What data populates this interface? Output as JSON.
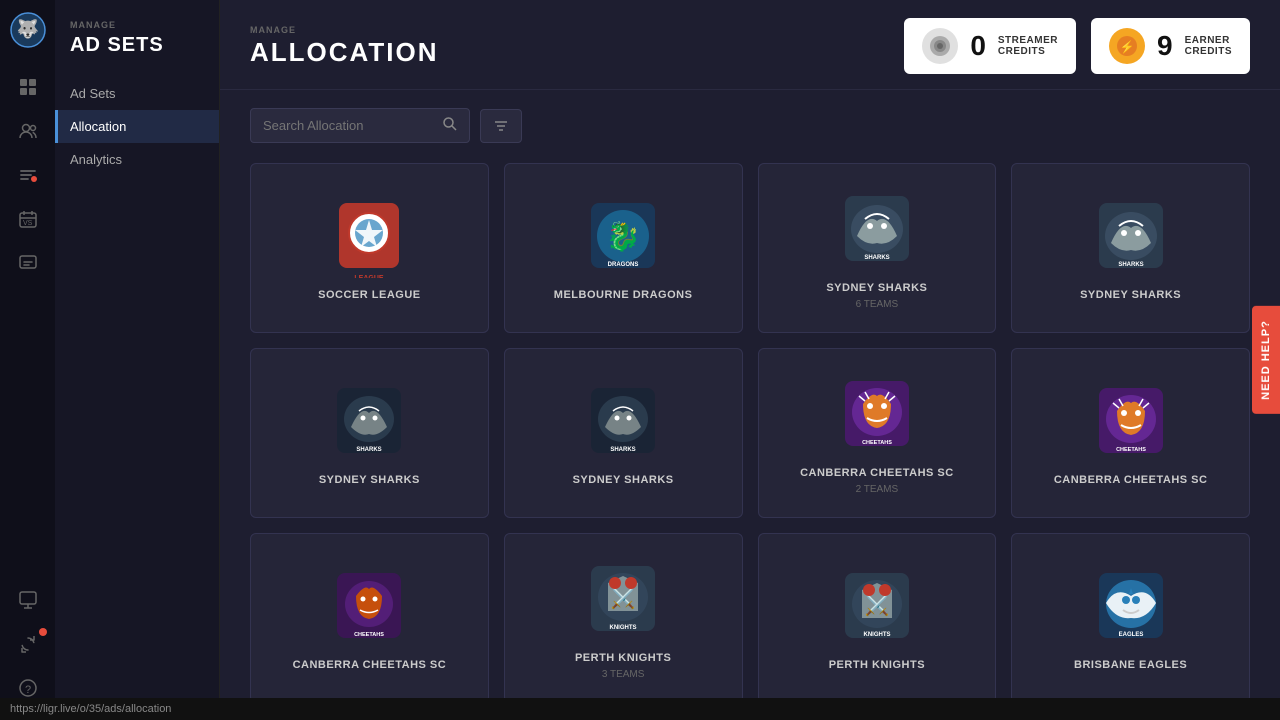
{
  "app": {
    "logo": "🐺",
    "status_bar_url": "https://ligr.live/o/35/ads/allocation"
  },
  "icon_bar": {
    "items": [
      {
        "name": "dashboard-icon",
        "icon": "▦",
        "active": false
      },
      {
        "name": "users-icon",
        "icon": "👥",
        "active": false
      },
      {
        "name": "campaigns-icon",
        "icon": "📢",
        "active": false
      },
      {
        "name": "calendar-icon",
        "icon": "📅",
        "active": false
      },
      {
        "name": "messages-icon",
        "icon": "💬",
        "active": false,
        "badge": false
      },
      {
        "name": "monitor-icon",
        "icon": "🖥",
        "active": false
      },
      {
        "name": "sync-icon",
        "icon": "↻",
        "active": false
      },
      {
        "name": "help-bottom-icon",
        "icon": "?",
        "active": false
      }
    ]
  },
  "sidebar": {
    "section_label": "MANAGE",
    "title": "AD SETS",
    "nav_items": [
      {
        "label": "Ad Sets",
        "active": false
      },
      {
        "label": "Allocation",
        "active": true
      },
      {
        "label": "Analytics",
        "active": false
      }
    ]
  },
  "header": {
    "section_label": "MANAGE",
    "title": "ALLOCATION",
    "streamer_credits": {
      "count": "0",
      "label_line1": "STREAMER",
      "label_line2": "CREDITS"
    },
    "earner_credits": {
      "count": "9",
      "label_line1": "EARNER",
      "label_line2": "CREDITS"
    }
  },
  "search": {
    "placeholder": "Search Allocation"
  },
  "help_tab": "NEED HELP?",
  "cards": [
    {
      "id": 1,
      "name": "SOCCER LEAGUE",
      "teams": "",
      "logo_type": "soccer_league",
      "color1": "#c0392b",
      "color2": "#2980b9"
    },
    {
      "id": 2,
      "name": "MELBOURNE DRAGONS",
      "teams": "",
      "logo_type": "dragons",
      "color1": "#1a6b9a",
      "color2": "#27ae60"
    },
    {
      "id": 3,
      "name": "SYDNEY SHARKS",
      "teams": "6 TEAMS",
      "logo_type": "sharks",
      "color1": "#2c3e50",
      "color2": "#7f8c8d"
    },
    {
      "id": 4,
      "name": "SYDNEY SHARKS",
      "teams": "",
      "logo_type": "sharks",
      "color1": "#2c3e50",
      "color2": "#7f8c8d"
    },
    {
      "id": 5,
      "name": "SYDNEY SHARKS",
      "teams": "",
      "logo_type": "sharks_sm",
      "color1": "#2c3e50",
      "color2": "#bdc3c7"
    },
    {
      "id": 6,
      "name": "SYDNEY SHARKS",
      "teams": "",
      "logo_type": "sharks_sm",
      "color1": "#2c3e50",
      "color2": "#bdc3c7"
    },
    {
      "id": 7,
      "name": "CANBERRA CHEETAHS SC",
      "teams": "2 TEAMS",
      "logo_type": "cheetahs",
      "color1": "#e67e22",
      "color2": "#8e44ad"
    },
    {
      "id": 8,
      "name": "CANBERRA CHEETAHS SC",
      "teams": "",
      "logo_type": "cheetahs",
      "color1": "#e67e22",
      "color2": "#8e44ad"
    },
    {
      "id": 9,
      "name": "CANBERRA CHEETAHS SC",
      "teams": "",
      "logo_type": "cheetahs_sm",
      "color1": "#d35400",
      "color2": "#7d3c98"
    },
    {
      "id": 10,
      "name": "PERTH KNIGHTS",
      "teams": "3 TEAMS",
      "logo_type": "knights",
      "color1": "#c0392b",
      "color2": "#34495e"
    },
    {
      "id": 11,
      "name": "PERTH KNIGHTS",
      "teams": "",
      "logo_type": "knights",
      "color1": "#c0392b",
      "color2": "#34495e"
    },
    {
      "id": 12,
      "name": "BRISBANE EAGLES",
      "teams": "",
      "logo_type": "eagles",
      "color1": "#2980b9",
      "color2": "#bdc3c7"
    }
  ]
}
